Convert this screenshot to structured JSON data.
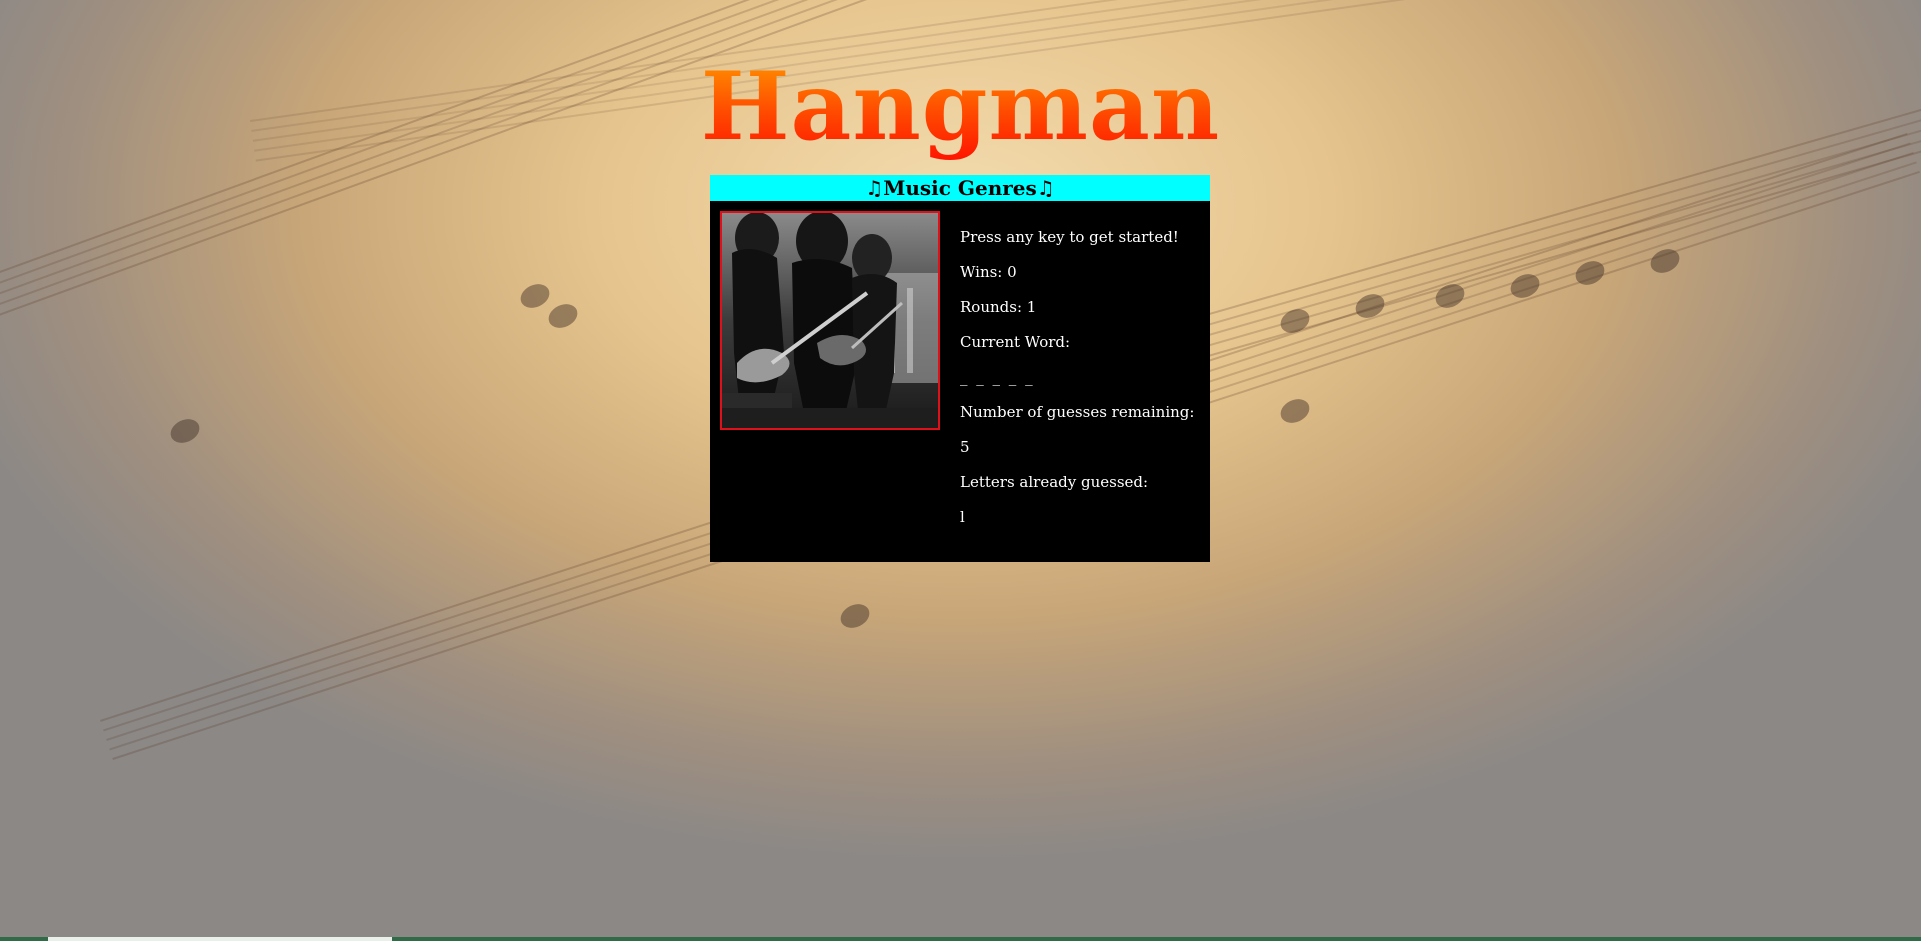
{
  "title": "Hangman",
  "panel": {
    "header": "♫Music Genres♫",
    "image": {
      "name": "rock-band-photo",
      "style": "black-and-white",
      "border_color": "#e0101a"
    },
    "prompt": "Press any key to get started!",
    "wins_text": "Wins: 0",
    "rounds_text": "Rounds: 1",
    "current_word_label": "Current Word:",
    "current_word_value": "_ _ _ _ _",
    "guesses_remaining_label": "Number of guesses remaining:",
    "guesses_remaining_value": "5",
    "letters_guessed_label": "Letters already guessed:",
    "letters_guessed_value": "l"
  },
  "colors": {
    "title_gradient_top": "#ff9a00",
    "title_gradient_bottom": "#ff1200",
    "header_background": "#00ffff",
    "panel_background": "#000000",
    "panel_text": "#ffffff"
  }
}
